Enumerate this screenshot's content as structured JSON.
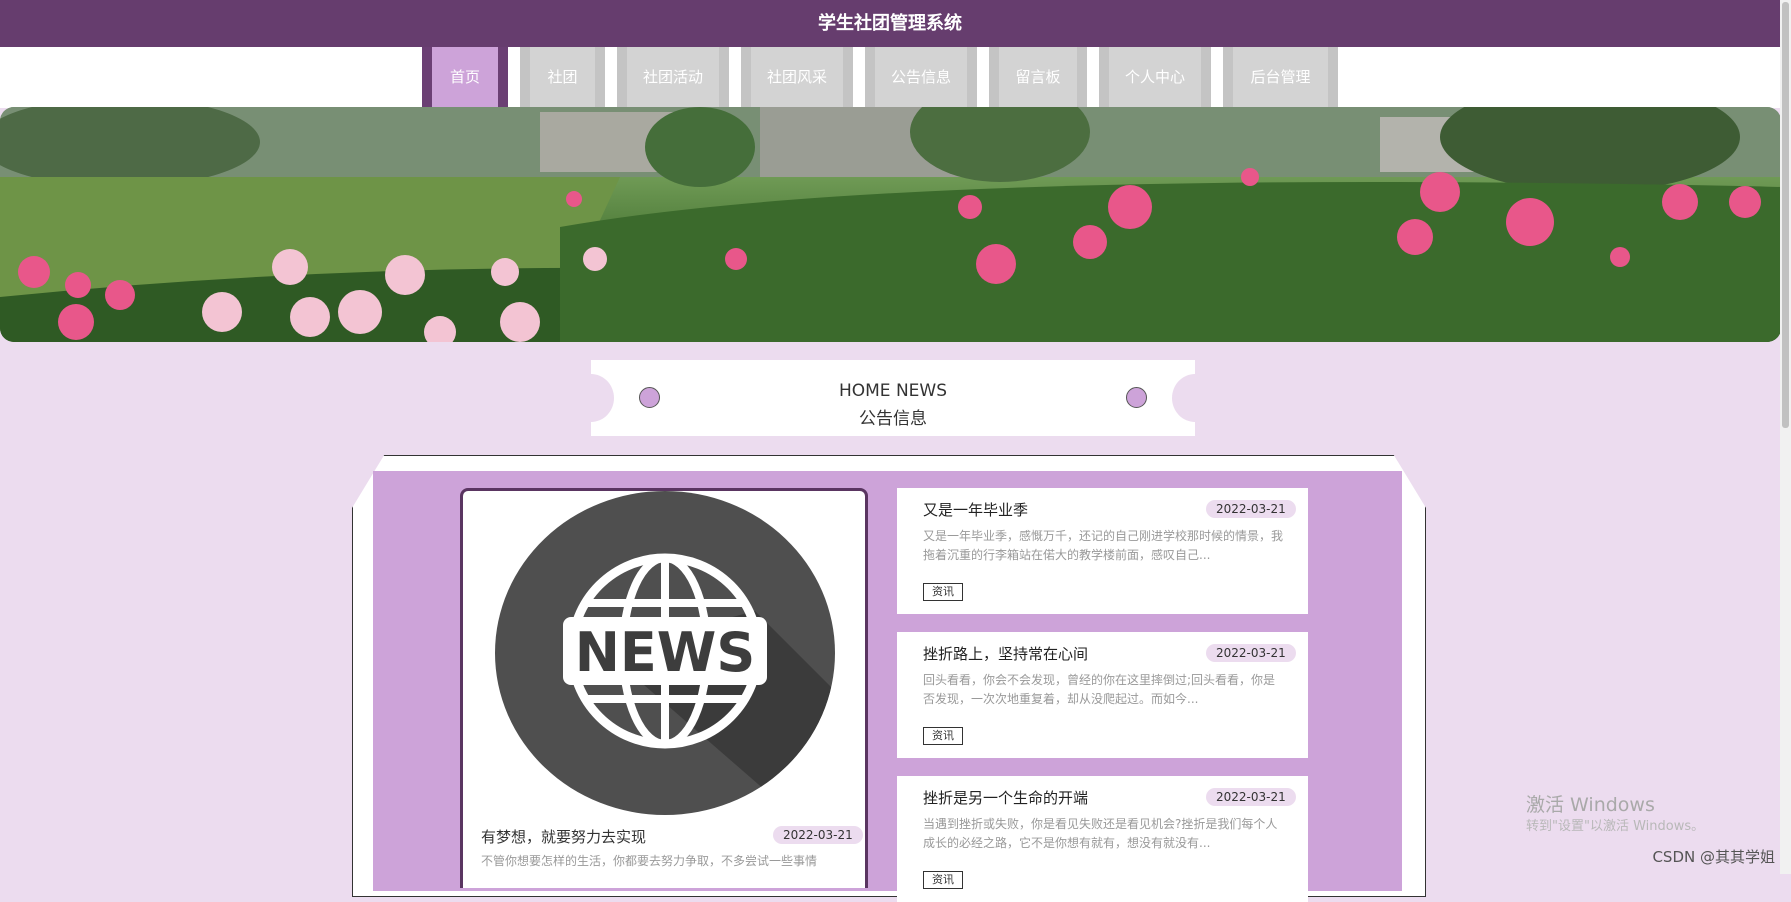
{
  "app_title": "学生社团管理系统",
  "nav": [
    "首页",
    "社团",
    "社团活动",
    "社团风采",
    "公告信息",
    "留言板",
    "个人中心",
    "后台管理"
  ],
  "section": {
    "title_en": "HOME NEWS",
    "title_cn": "公告信息"
  },
  "featured": {
    "image_text": "NEWS",
    "title": "有梦想，就要努力去实现",
    "date": "2022-03-21",
    "text": "不管你想要怎样的生活，你都要去努力争取，不多尝试一些事情"
  },
  "news": [
    {
      "title": "又是一年毕业季",
      "date": "2022-03-21",
      "text": "又是一年毕业季，感慨万千，还记的自己刚进学校那时候的情景，我拖着沉重的行李箱站在偌大的教学楼前面，感叹自己...",
      "tag": "资讯"
    },
    {
      "title": "挫折路上，坚持常在心间",
      "date": "2022-03-21",
      "text": "回头看看，你会不会发现，曾经的你在这里摔倒过;回头看看，你是否发现，一次次地重复着，却从没爬起过。而如今...",
      "tag": "资讯"
    },
    {
      "title": "挫折是另一个生命的开端",
      "date": "2022-03-21",
      "text": "当遇到挫折或失败，你是看见失败还是看见机会?挫折是我们每个人成长的必经之路，它不是你想有就有，想没有就没有...",
      "tag": "资讯"
    }
  ],
  "watermark": {
    "line1": "激活 Windows",
    "line2": "转到\"设置\"以激活 Windows。"
  },
  "credit": "CSDN @其其学姐",
  "colors": {
    "header": "#663d6e",
    "accent": "#cda3d9",
    "background": "#ecdcef"
  }
}
